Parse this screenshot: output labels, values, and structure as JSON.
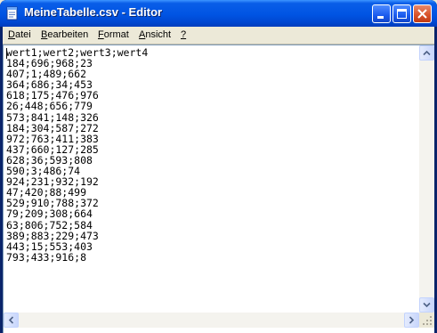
{
  "window": {
    "title": "MeineTabelle.csv - Editor",
    "titlebar_color": "#0054e3",
    "close_color": "#d9542b"
  },
  "icons": {
    "app": "notepad-icon",
    "minimize": "minimize-icon",
    "maximize": "maximize-icon",
    "close": "close-icon",
    "scroll_up": "arrow-up-icon",
    "scroll_down": "arrow-down-icon",
    "scroll_left": "arrow-left-icon",
    "scroll_right": "arrow-right-icon",
    "resize_grip": "resize-grip-icon"
  },
  "menu": {
    "datei": {
      "accel": "D",
      "rest": "atei"
    },
    "bearbeiten": {
      "accel": "B",
      "rest": "earbeiten"
    },
    "format": {
      "accel": "F",
      "rest": "ormat"
    },
    "ansicht": {
      "accel": "A",
      "rest": "nsicht"
    },
    "help": {
      "accel": "?",
      "rest": ""
    }
  },
  "editor": {
    "lines": [
      "wert1;wert2;wert3;wert4",
      "184;696;968;23",
      "407;1;489;662",
      "364;686;34;453",
      "618;175;476;976",
      "26;448;656;779",
      "573;841;148;326",
      "184;304;587;272",
      "972;763;411;383",
      "437;660;127;285",
      "628;36;593;808",
      "590;3;486;74",
      "924;231;932;192",
      "47;420;88;499",
      "529;910;788;372",
      "79;209;308;664",
      "63;806;752;584",
      "389;883;229;473",
      "443;15;553;403",
      "793;433;916;8"
    ]
  }
}
